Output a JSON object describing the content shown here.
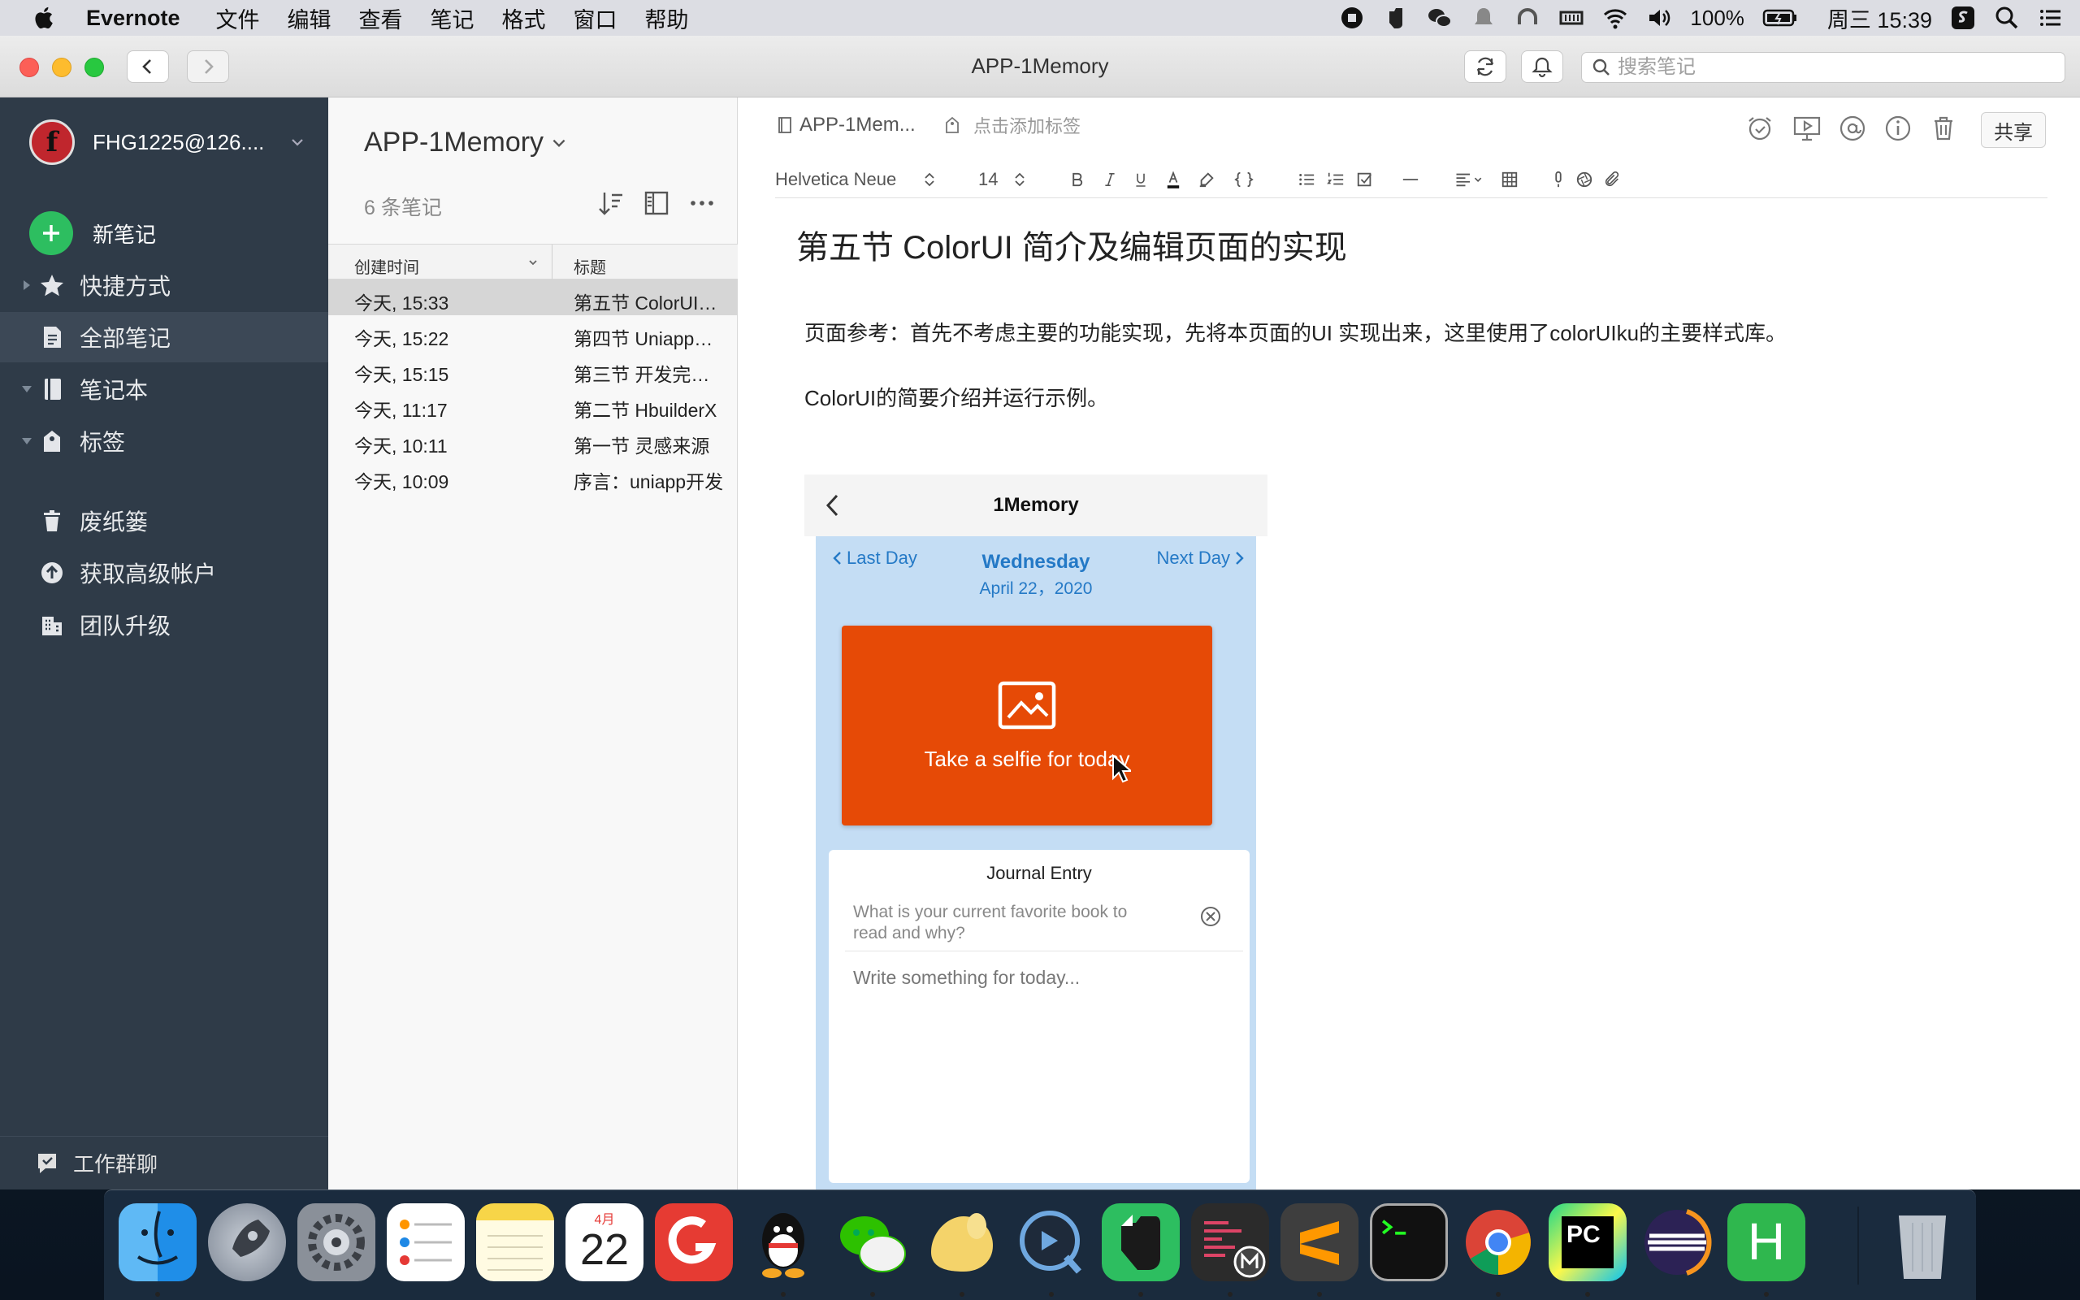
{
  "menubar": {
    "app_name": "Evernote",
    "menus": [
      "文件",
      "编辑",
      "查看",
      "笔记",
      "格式",
      "窗口",
      "帮助"
    ],
    "battery": "100%",
    "clock": "周三 15:39"
  },
  "window": {
    "title": "APP-1Memory",
    "search_placeholder": "搜索笔记"
  },
  "sidebar": {
    "account": "FHG1225@126....",
    "avatar_letter": "f",
    "new_note": "新笔记",
    "items": [
      {
        "label": "快捷方式",
        "icon": "star-icon"
      },
      {
        "label": "全部笔记",
        "icon": "note-icon"
      },
      {
        "label": "笔记本",
        "icon": "notebook-icon"
      },
      {
        "label": "标签",
        "icon": "tag-icon"
      },
      {
        "label": "废纸篓",
        "icon": "trash-icon"
      },
      {
        "label": "获取高级帐户",
        "icon": "upgrade-icon"
      },
      {
        "label": "团队升级",
        "icon": "building-icon"
      }
    ],
    "footer": "工作群聊"
  },
  "notelist": {
    "notebook": "APP-1Memory",
    "count": "6 条笔记",
    "col_created": "创建时间",
    "col_title": "标题",
    "rows": [
      {
        "time": "今天, 15:33",
        "title": "第五节 ColorUI简介及编辑页面的实现"
      },
      {
        "time": "今天, 15:22",
        "title": "第四节 Uniapp的使用"
      },
      {
        "time": "今天, 15:15",
        "title": "第三节 开发完成的功能"
      },
      {
        "time": "今天, 11:17",
        "title": "第二节 HbuilderX"
      },
      {
        "time": "今天, 10:11",
        "title": "第一节 灵感来源"
      },
      {
        "time": "今天, 10:09",
        "title": "序言：uniapp开发"
      }
    ]
  },
  "editor": {
    "notebook_crumb": "APP-1Mem...",
    "tag_placeholder": "点击添加标签",
    "share": "共享",
    "font": "Helvetica Neue",
    "size": "14",
    "title": "第五节 ColorUI 简介及编辑页面的实现",
    "para1": "页面参考：首先不考虑主要的功能实现，先将本页面的UI 实现出来，这里使用了colorUIku的主要样式库。",
    "para2": "ColorUI的简要介绍并运行示例。"
  },
  "phone": {
    "nav_title": "1Memory",
    "last_day": "Last Day",
    "next_day": "Next Day",
    "weekday": "Wednesday",
    "date": "April 22，2020",
    "selfie": "Take a selfie for today",
    "journal_title": "Journal Entry",
    "prompt": "What is your current favorite book to read and why?",
    "write_placeholder": "Write something for today...",
    "accent": "#2479c6",
    "selfie_color": "#e64a06"
  },
  "dock": {
    "apps": [
      "finder-icon",
      "launchpad-icon",
      "system-preferences-icon",
      "reminders-icon",
      "notes-icon",
      "calendar-icon",
      "git-client-icon",
      "qq-icon",
      "wechat-icon",
      "blob-app-icon",
      "quicktime-icon",
      "evernote-icon",
      "mail-script-icon",
      "sublime-text-icon",
      "terminal-icon",
      "chrome-icon",
      "pycharm-icon",
      "eclipse-icon",
      "hbuilder-icon",
      "trash-icon"
    ],
    "calendar_month": "4月",
    "calendar_day": "22",
    "pycharm_label": "PC",
    "hbuilder_label": "H"
  }
}
